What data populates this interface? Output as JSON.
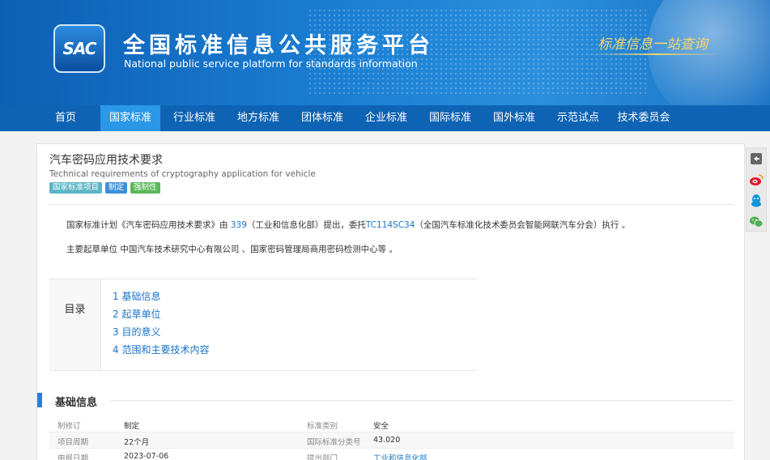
{
  "header": {
    "logo_text": "SAC",
    "title_cn": "全国标准信息公共服务平台",
    "title_en": "National public service platform  for standards information",
    "slogan": "标准信息一站查询"
  },
  "nav": {
    "items": [
      "首页",
      "国家标准",
      "行业标准",
      "地方标准",
      "团体标准",
      "企业标准",
      "国际标准",
      "国外标准",
      "示范试点",
      "技术委员会"
    ],
    "active_index": 1
  },
  "standard": {
    "title": "汽车密码应用技术要求",
    "subtitle": "Technical requirements of cryptography application for vehicle",
    "tags": [
      {
        "label": "国家标准项目",
        "color": "#5bb5c6"
      },
      {
        "label": "制定",
        "color": "#3f8fd6"
      },
      {
        "label": "强制性",
        "color": "#5cb85c"
      }
    ],
    "desc1": {
      "prefix": "国家标准计划《汽车密码应用技术要求》由 ",
      "link1": "339",
      "mid": "（工业和信息化部）提出，委托",
      "link2": "TC114SC34",
      "suffix": "（全国汽车标准化技术委员会智能网联汽车分会）执行 。"
    },
    "desc2": "主要起草单位 中国汽车技术研究中心有限公司 、国家密码管理局商用密码检测中心等 。"
  },
  "toc": {
    "label": "目录",
    "items": [
      "1  基础信息",
      "2  起草单位",
      "3  目的意义",
      "4  范围和主要技术内容"
    ]
  },
  "basic_info": {
    "title": "基础信息",
    "rows": [
      {
        "k1": "制修订",
        "v1": "制定",
        "k2": "标准类别",
        "v2": "安全",
        "v2_link": false
      },
      {
        "k1": "项目周期",
        "v1": "22个月",
        "k2": "国际标准分类号",
        "v2": "43.020",
        "v2_link": false
      },
      {
        "k1": "申报日期",
        "v1": "2023-07-06",
        "k2": "提出部门",
        "v2": "工业和信息化部",
        "v2_link": true
      }
    ]
  },
  "side_toolbar": {
    "icons": [
      "back-icon",
      "weibo-icon",
      "qq-icon",
      "wechat-icon"
    ]
  },
  "colors": {
    "nav_bg": "#0f63b4",
    "nav_active": "#2a97e8",
    "link": "#1a73c6",
    "slogan": "#f4d66b"
  }
}
